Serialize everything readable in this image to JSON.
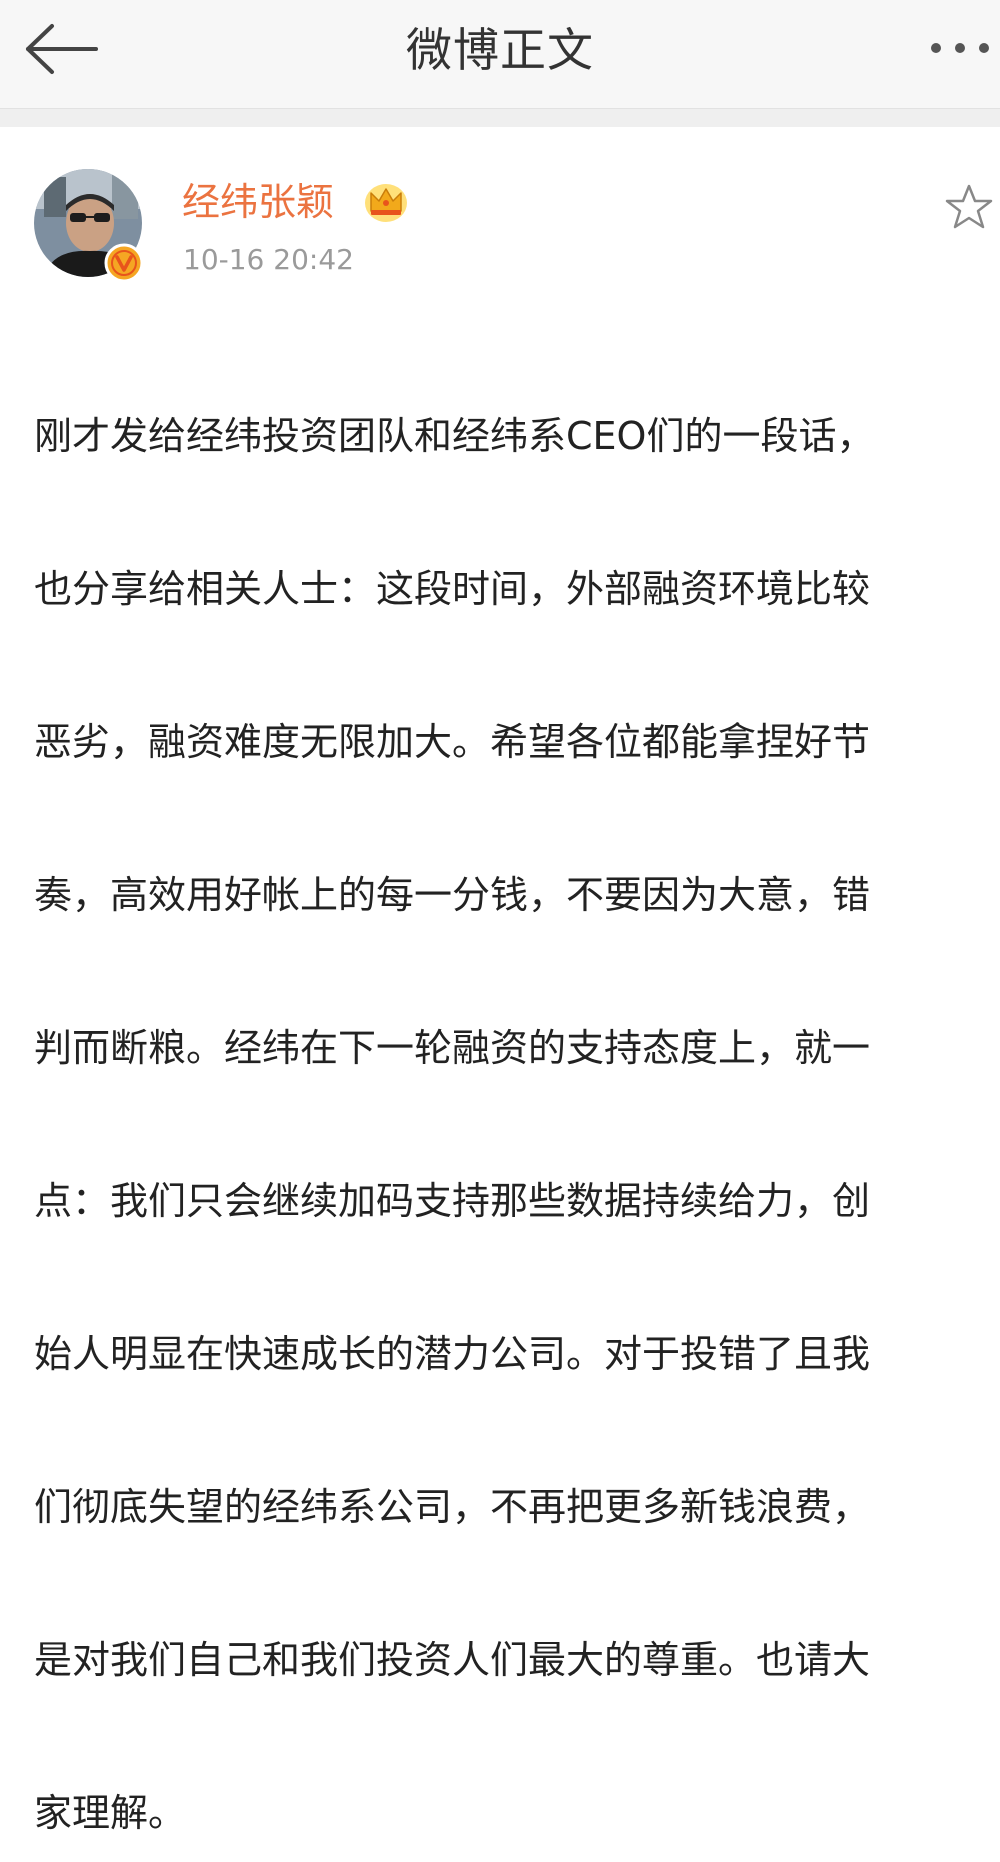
{
  "nav": {
    "title": "微博正文",
    "back_icon": "arrow-left-icon",
    "more_icon": "more-dots-icon"
  },
  "post": {
    "author": "经纬张颖",
    "author_color": "#eb7340",
    "author_badge_icon": "crown-icon",
    "verified_icon": "verified-v-icon",
    "verified_color": "#f5a623",
    "timestamp": "10-16 20:42",
    "favorite_icon": "star-outline-icon",
    "body_lines": [
      "刚才发给经纬投资团队和经纬系CEO们的一段话，",
      "也分享给相关人士：这段时间，外部融资环境比较",
      "恶劣，融资难度无限加大。希望各位都能拿捏好节",
      "奏，高效用好帐上的每一分钱，不要因为大意，错",
      "判而断粮。经纬在下一轮融资的支持态度上，就一",
      "点：我们只会继续加码支持那些数据持续给力，创",
      "始人明显在快速成长的潜力公司。对于投错了且我",
      "们彻底失望的经纬系公司，不再把更多新钱浪费，",
      "是对我们自己和我们投资人们最大的尊重。也请大",
      "家理解。"
    ]
  }
}
